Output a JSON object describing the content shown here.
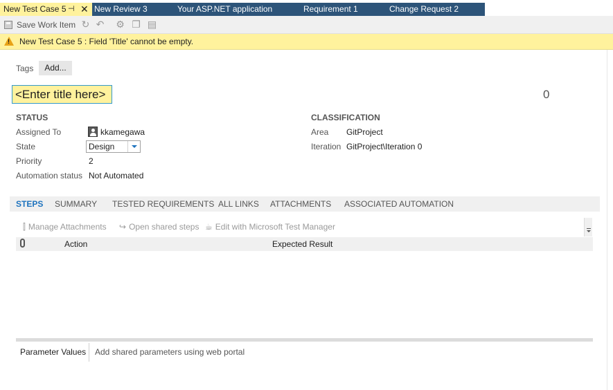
{
  "tabs": [
    {
      "label": "New Test Case 5",
      "active": true
    },
    {
      "label": "New Review 3"
    },
    {
      "label": "Your ASP.NET application"
    },
    {
      "label": "Requirement 1"
    },
    {
      "label": "Change Request 2"
    }
  ],
  "toolbar": {
    "save_label": "Save Work Item",
    "icons": [
      "save-icon",
      "refresh-icon",
      "undo-icon",
      "bulk-edit-icon",
      "copy-icon",
      "template-icon"
    ]
  },
  "error": {
    "message": "New Test Case 5 : Field 'Title' cannot be empty."
  },
  "tags": {
    "label": "Tags",
    "add_label": "Add..."
  },
  "title": {
    "placeholder": "<Enter title here>",
    "id": "0"
  },
  "status": {
    "heading": "STATUS",
    "assigned_label": "Assigned To",
    "assigned_value": "kkamegawa",
    "state_label": "State",
    "state_value": "Design",
    "priority_label": "Priority",
    "priority_value": "2",
    "automation_label": "Automation status",
    "automation_value": "Not Automated"
  },
  "classification": {
    "heading": "CLASSIFICATION",
    "area_label": "Area",
    "area_value": "GitProject",
    "iteration_label": "Iteration",
    "iteration_value": "GitProject\\Iteration 0"
  },
  "form_tabs": [
    "STEPS",
    "SUMMARY",
    "TESTED REQUIREMENTS",
    "ALL LINKS",
    "ATTACHMENTS",
    "ASSOCIATED AUTOMATION"
  ],
  "steps_toolbar": {
    "manage": "Manage Attachments",
    "open_shared": "Open shared steps",
    "edit_mtm": "Edit with Microsoft Test Manager"
  },
  "grid": {
    "action_header": "Action",
    "expected_header": "Expected Result"
  },
  "params": {
    "label": "Parameter Values",
    "link": "Add shared parameters using web portal"
  },
  "colors": {
    "tab_bar": "#2d5479",
    "active_tab": "#fff29d",
    "error_bar": "#fff29d",
    "accent": "#1e73be"
  }
}
